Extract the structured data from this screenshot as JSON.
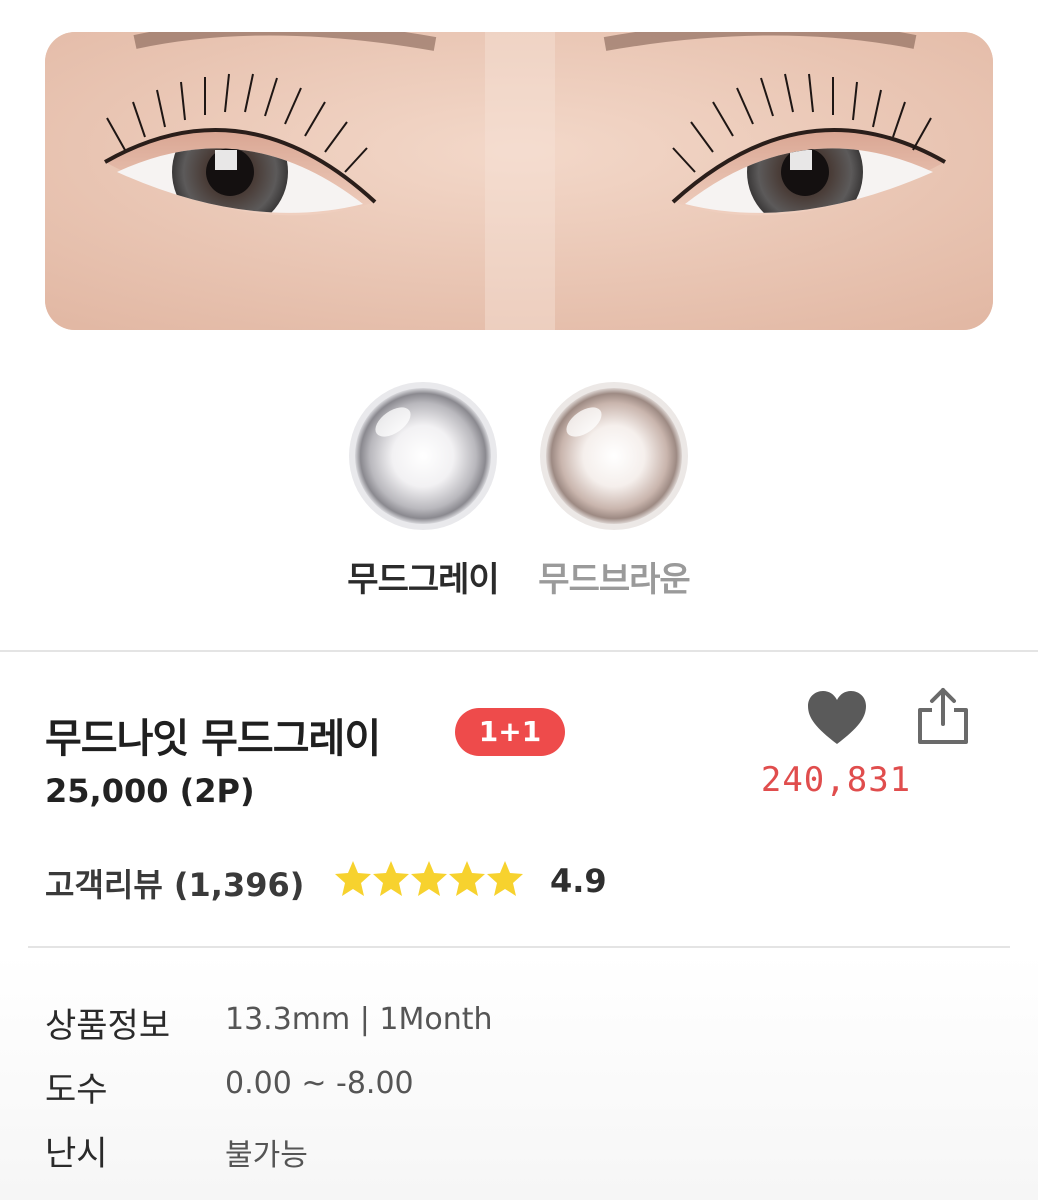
{
  "options": [
    {
      "label": "무드그레이",
      "selected": true
    },
    {
      "label": "무드브라운",
      "selected": false
    }
  ],
  "product": {
    "name": "무드나잇 무드그레이",
    "promo_badge": "1+1",
    "price": "25,000 (2P)",
    "like_count": "240,831",
    "review_label": "고객리뷰 (1,396)",
    "rating_stars": 5,
    "rating": "4.9"
  },
  "specs": [
    {
      "label": "상품정보",
      "value": "13.3mm | 1Month"
    },
    {
      "label": "도수",
      "value": "0.00 ~ -8.00"
    },
    {
      "label": "난시",
      "value": "불가능"
    }
  ],
  "colors": {
    "badge": "#ee4b4b",
    "like_count": "#e04d4d",
    "star": "#f7d22e",
    "heart": "#5a5a5a"
  },
  "icons": [
    "heart-icon",
    "share-icon",
    "star-icon"
  ]
}
